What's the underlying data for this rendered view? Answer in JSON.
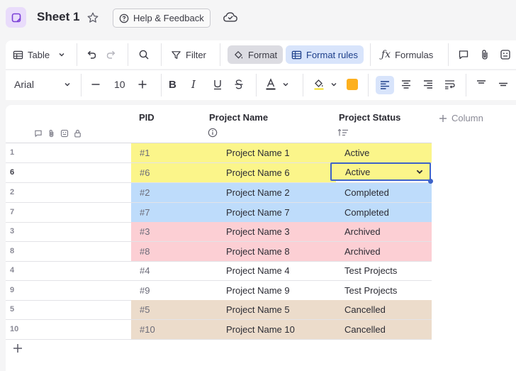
{
  "header": {
    "sheet_title": "Sheet 1",
    "help_label": "Help & Feedback"
  },
  "toolbar": {
    "view_label": "Table",
    "filter_label": "Filter",
    "format_label": "Format",
    "format_rules_label": "Format rules",
    "formulas_label": "Formulas"
  },
  "format_bar": {
    "font_family": "Arial",
    "font_size": "10",
    "fill_color": "#fdb01e",
    "highlight_color": "#f2dc25"
  },
  "columns": [
    {
      "label": "PID"
    },
    {
      "label": "Project Name"
    },
    {
      "label": "Project Status"
    }
  ],
  "add_column_label": "Column",
  "rows": [
    {
      "num": "1",
      "pid": "#1",
      "name": "Project Name 1",
      "status": "Active",
      "color": "yellow"
    },
    {
      "num": "6",
      "pid": "#6",
      "name": "Project Name 6",
      "status": "Active",
      "color": "yellow"
    },
    {
      "num": "2",
      "pid": "#2",
      "name": "Project Name 2",
      "status": "Completed",
      "color": "blue"
    },
    {
      "num": "7",
      "pid": "#7",
      "name": "Project Name 7",
      "status": "Completed",
      "color": "blue"
    },
    {
      "num": "3",
      "pid": "#3",
      "name": "Project Name 3",
      "status": "Archived",
      "color": "pink"
    },
    {
      "num": "8",
      "pid": "#8",
      "name": "Project Name 8",
      "status": "Archived",
      "color": "pink"
    },
    {
      "num": "4",
      "pid": "#4",
      "name": "Project Name 4",
      "status": "Test Projects",
      "color": "none"
    },
    {
      "num": "9",
      "pid": "#9",
      "name": "Project Name 9",
      "status": "Test Projects",
      "color": "none"
    },
    {
      "num": "5",
      "pid": "#5",
      "name": "Project Name 5",
      "status": "Cancelled",
      "color": "tan"
    },
    {
      "num": "10",
      "pid": "#10",
      "name": "Project Name 10",
      "status": "Cancelled",
      "color": "tan"
    }
  ],
  "selected_cell": {
    "value": "Active"
  },
  "colors": {
    "accent": "#3e63c8",
    "active": "#fbf58a",
    "completed": "#bedcfb",
    "archived": "#fccfd4",
    "cancelled": "#ecdccb"
  }
}
